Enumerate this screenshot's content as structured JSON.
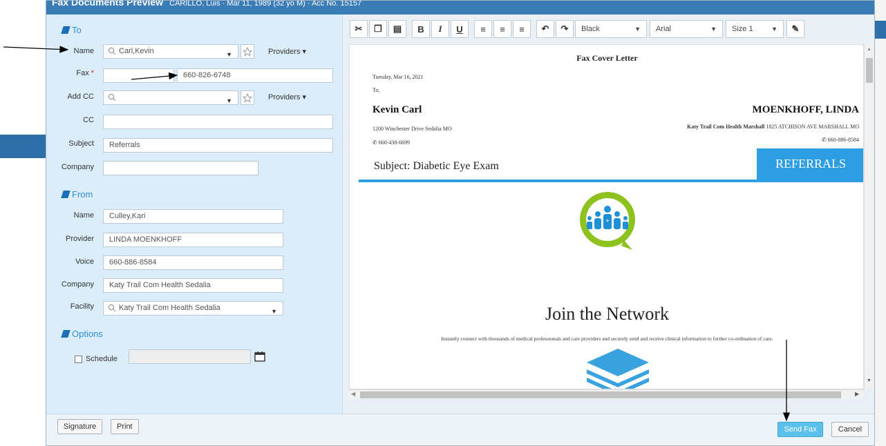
{
  "title": {
    "main": "Fax Documents Preview",
    "sub": "CARILLO, Luis  ·  Mar 11, 1989 (32 yo M)  ·  Acc No. 15157"
  },
  "to": {
    "heading": "To",
    "name_label": "Name",
    "name_value": "Carl,Kevin",
    "providers_label": "Providers",
    "fax_label": "Fax",
    "fax_required": "*",
    "fax_prefix": "",
    "fax_value": "660-826-6748",
    "addcc_label": "Add CC",
    "addcc_value": "",
    "cc_label": "CC",
    "cc_value": "",
    "subject_label": "Subject",
    "subject_value": "Referrals",
    "company_label": "Company",
    "company_value": ""
  },
  "from": {
    "heading": "From",
    "name_label": "Name",
    "name_value": "Culley,Kari",
    "provider_label": "Provider",
    "provider_value": "LINDA  MOENKHOFF",
    "voice_label": "Voice",
    "voice_value": "660-886-8584",
    "company_label": "Company",
    "company_value": "Katy Trail Com Health Sedalia",
    "facility_label": "Facility",
    "facility_value": "Katy Trail Com Health Sedalia"
  },
  "options": {
    "heading": "Options",
    "schedule_label": "Schedule",
    "schedule_value": ""
  },
  "toolbar": {
    "color": "Black",
    "font": "Arial",
    "size": "Size 1"
  },
  "doc": {
    "heading": "Fax Cover Letter",
    "date": "Tuesday, Mar 16, 2021",
    "to": "To,",
    "recipient_name": "Kevin Carl",
    "recipient_address": "1200 Winchester Drive Sedalia MO",
    "recipient_phone": "660-438-6699",
    "sender_name": "MOENKHOFF, LINDA",
    "sender_org": "Katy Trail Com Health Marshall",
    "sender_address": " 1825 ATCHISON AVE MARSHALL MO",
    "sender_phone": "660-886-8584",
    "subject": "Subject: Diabetic Eye Exam",
    "banner": "REFERRALS",
    "network_title": "Join the Network",
    "network_text": "Instantly connect with thousands of medical professionals and care providers and securely send and receive clinical information to further co-ordination of care."
  },
  "footer": {
    "signature": "Signature",
    "print": "Print",
    "send_fax": "Send Fax",
    "cancel": "Cancel"
  },
  "colors": {
    "accent": "#2f8fd5",
    "banner": "#2e9ee3",
    "logo_green": "#8dc21f",
    "send_button": "#5bc0ea"
  }
}
